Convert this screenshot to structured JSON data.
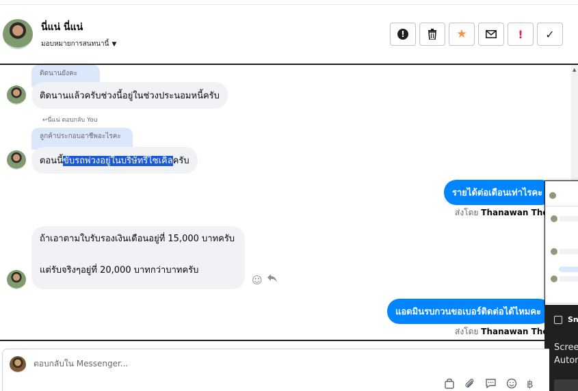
{
  "header": {
    "name": "นี่แน่ นี่แน่",
    "assignment": "มอบหมายการสนทนานี้",
    "caret_icon": "caret-down-icon",
    "actions": [
      {
        "name": "info-button",
        "icon": "exclamation-circle-icon",
        "glyph": "!"
      },
      {
        "name": "delete-button",
        "icon": "trash-icon",
        "glyph": "🗑"
      },
      {
        "name": "star-button",
        "icon": "star-icon",
        "glyph": "★"
      },
      {
        "name": "mail-button",
        "icon": "envelope-icon",
        "glyph": "✉"
      },
      {
        "name": "spam-button",
        "icon": "exclamation-icon",
        "glyph": "!"
      },
      {
        "name": "done-button",
        "icon": "check-icon",
        "glyph": "✓"
      }
    ]
  },
  "messages": {
    "m1": {
      "quote": "ติดนานยังคะ",
      "text": "ติดนานแล้วครับช่วงนี้อยู่ในช่วงประนอมหนี้ครับ"
    },
    "m2": {
      "reply_note": "↩นี่แน่ ตอบกลับ You",
      "quote": "ลูกค้าประกอบอาชีพอะไรคะ",
      "text_before": "ตอนนี้",
      "text_highlight": "ขับรถพ่วงอยู่ในบริษัทรีไซเคิล",
      "text_after": "ครับ"
    },
    "m3": {
      "text": "รายได้ต่อเดือนเท่าไรคะ",
      "sent_prefix": "ส่งโดย",
      "sent_by": "Thanawan Thon"
    },
    "m4": {
      "line1": "ถ้าเอาตามใบรับรองเงินเดือนอยู่ที่ 15,000 บาทครับ",
      "line2": "แต่รับจริงๆอยู่ที่ 20,000 บาทกว่าบาทครับ"
    },
    "m5": {
      "text": "แอดมินรบกวนขอเบอร์ติดต่อได้ไหมคะ",
      "sent_prefix": "ส่งโดย",
      "sent_by": "Thanawan Thon"
    }
  },
  "reactions": {
    "emoji_icon": "smiley-icon",
    "reply_icon": "reply-arrow-icon"
  },
  "toast": {
    "title": "Sn",
    "body_line1": "Scree",
    "body_line2": "Auton"
  },
  "composer": {
    "placeholder": "ตอบกลับใน Messenger...",
    "tools": [
      {
        "name": "bag-icon",
        "glyph": "👜"
      },
      {
        "name": "paperclip-icon",
        "glyph": "📎"
      },
      {
        "name": "speech-bubble-icon",
        "glyph": "💬"
      },
      {
        "name": "emoji-icon",
        "glyph": "☺"
      },
      {
        "name": "baht-icon",
        "glyph": "฿"
      }
    ]
  },
  "colors": {
    "accent": "#0084ff",
    "highlight": "#1a58d6",
    "star": "#f7923b",
    "danger": "#e41e3f"
  }
}
